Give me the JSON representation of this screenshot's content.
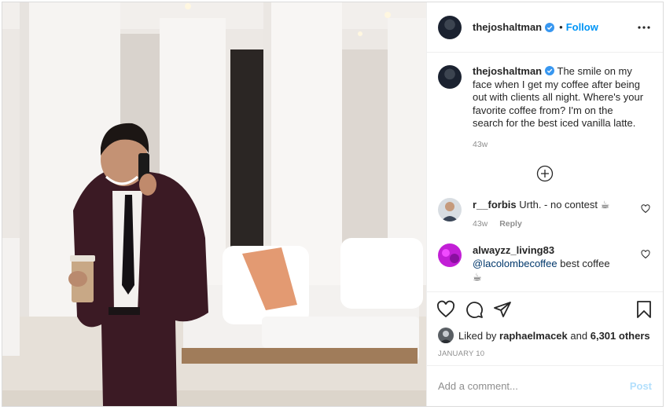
{
  "post": {
    "author": "thejoshaltman",
    "follow_label": "Follow",
    "separator": "•",
    "caption": "The smile on my face when I get my coffee after being out with clients all night. Where's your favorite coffee from? I'm on the search for the best iced vanilla latte.",
    "caption_time": "43w",
    "date": "JANUARY 10"
  },
  "comments": [
    {
      "username": "r__forbis",
      "text": "Urth. - no contest ☕",
      "time": "43w",
      "reply_label": "Reply"
    },
    {
      "username": "alwayzz_living83",
      "mention": "@lacolombecoffee",
      "text": " best coffee",
      "emoji": "☕"
    }
  ],
  "likes": {
    "prefix": "Liked by",
    "liker": "raphaelmacek",
    "joiner": "and",
    "others": "6,301 others"
  },
  "comment_box": {
    "placeholder": "Add a comment...",
    "post_label": "Post"
  },
  "colors": {
    "accent": "#0095f6",
    "post_disabled": "#b2dffc",
    "muted": "#8e8e8e"
  }
}
